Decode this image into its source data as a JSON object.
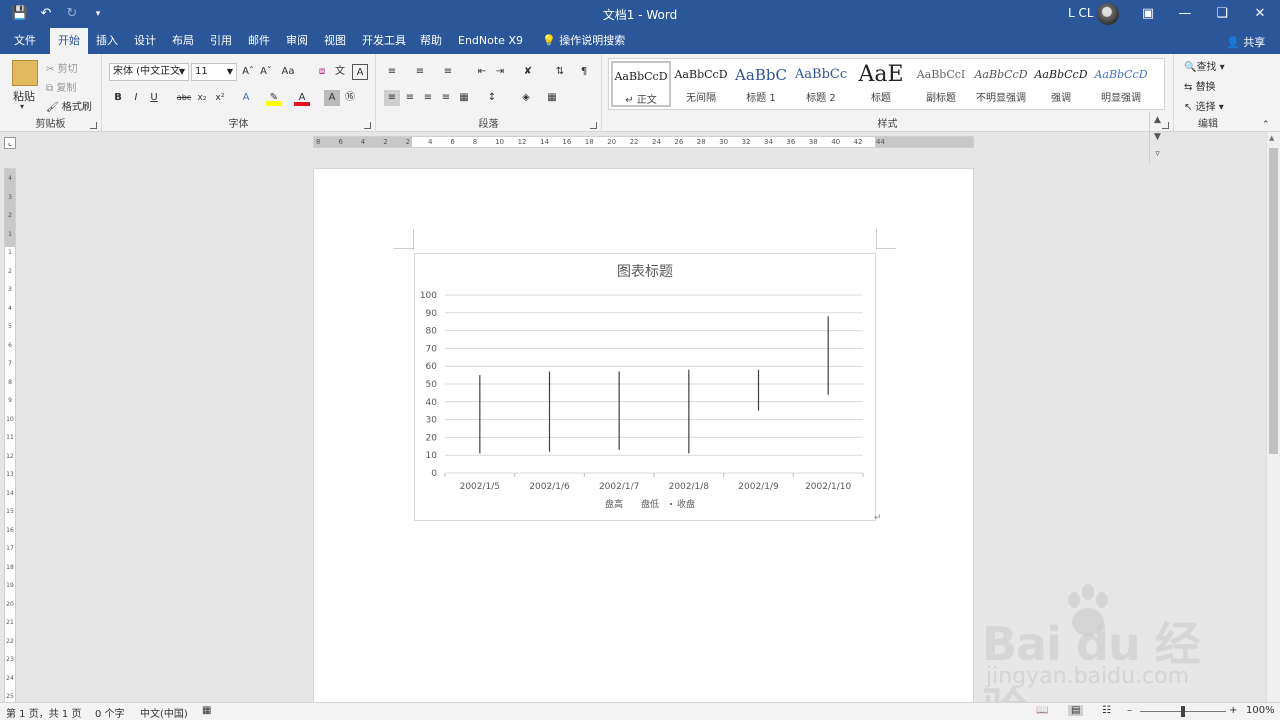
{
  "window": {
    "title": "文档1 - Word",
    "user": "L CL"
  },
  "tabs": [
    "文件",
    "开始",
    "插入",
    "设计",
    "布局",
    "引用",
    "邮件",
    "审阅",
    "视图",
    "开发工具",
    "帮助",
    "EndNote X9"
  ],
  "active_tab": "开始",
  "tell_me": "操作说明搜索",
  "share": "共享",
  "clipboard": {
    "label": "剪贴板",
    "paste": "粘贴",
    "cut": "剪切",
    "copy": "复制",
    "format_painter": "格式刷"
  },
  "font": {
    "label": "字体",
    "name": "宋体 (中文正文",
    "size": "11"
  },
  "paragraph": {
    "label": "段落"
  },
  "styles": {
    "label": "样式",
    "items": [
      {
        "sample": "AaBbCcD",
        "name": "↵ 正文"
      },
      {
        "sample": "AaBbCcD",
        "name": "无间隔"
      },
      {
        "sample": "AaBbC",
        "name": "标题 1"
      },
      {
        "sample": "AaBbCc",
        "name": "标题 2"
      },
      {
        "sample": "AaE",
        "name": "标题"
      },
      {
        "sample": "AaBbCcI",
        "name": "副标题"
      },
      {
        "sample": "AaBbCcD",
        "name": "不明显强调"
      },
      {
        "sample": "AaBbCcD",
        "name": "强调"
      },
      {
        "sample": "AaBbCcD",
        "name": "明显强调"
      }
    ]
  },
  "editing": {
    "label": "编辑",
    "find": "查找",
    "replace": "替换",
    "select": "选择"
  },
  "ruler_h": [
    "8",
    "6",
    "4",
    "2",
    "2",
    "4",
    "6",
    "8",
    "10",
    "12",
    "14",
    "16",
    "18",
    "20",
    "22",
    "24",
    "26",
    "28",
    "30",
    "32",
    "34",
    "36",
    "38",
    "40",
    "42",
    "44"
  ],
  "chart_data": {
    "type": "stock",
    "title": "图表标题",
    "categories": [
      "2002/1/5",
      "2002/1/6",
      "2002/1/7",
      "2002/1/8",
      "2002/1/9",
      "2002/1/10"
    ],
    "series": [
      {
        "name": "盘高",
        "values": [
          55,
          57,
          57,
          58,
          58,
          88
        ]
      },
      {
        "name": "盘低",
        "values": [
          11,
          12,
          13,
          11,
          35,
          44
        ]
      },
      {
        "name": "收盘",
        "values": [
          null,
          null,
          null,
          null,
          null,
          null
        ]
      }
    ],
    "ylim": [
      0,
      100
    ],
    "yticks": [
      0,
      10,
      20,
      30,
      40,
      50,
      60,
      70,
      80,
      90,
      100
    ],
    "grid": true,
    "legend": "bottom"
  },
  "status": {
    "page": "第 1 页，共 1 页",
    "words": "0 个字",
    "lang": "中文(中国)",
    "zoom": "100%"
  },
  "watermark": {
    "text": "Bai  du 经验",
    "sub": "jingyan.baidu.com"
  }
}
